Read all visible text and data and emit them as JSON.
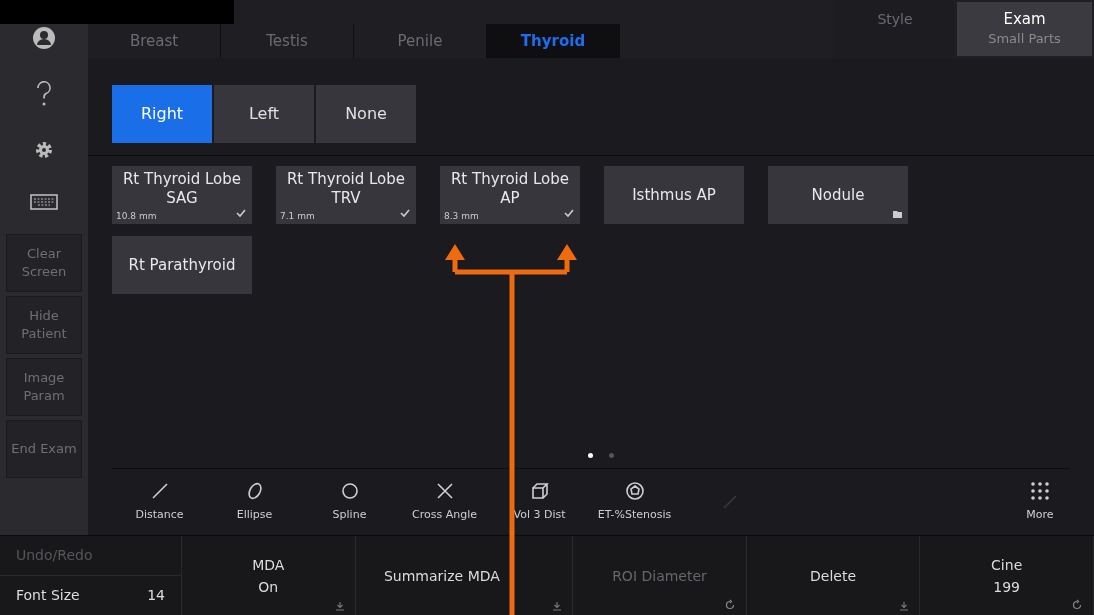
{
  "top_tabs": [
    {
      "label": "Breast",
      "selected": false
    },
    {
      "label": "Testis",
      "selected": false
    },
    {
      "label": "Penile",
      "selected": false
    },
    {
      "label": "Thyroid",
      "selected": true
    }
  ],
  "style_button": {
    "label": "Style",
    "disabled": true
  },
  "exam_button": {
    "label": "Exam",
    "value": "Small Parts"
  },
  "sidebar_buttons": [
    "Clear Screen",
    "Hide Patient",
    "Image Param",
    "End Exam"
  ],
  "sides": [
    {
      "label": "Right",
      "selected": true
    },
    {
      "label": "Left",
      "selected": false
    },
    {
      "label": "None",
      "selected": false
    }
  ],
  "measurements": [
    {
      "label": "Rt  Thyroid Lobe SAG",
      "value": "10.8 mm",
      "kind": "done"
    },
    {
      "label": "Rt  Thyroid Lobe TRV",
      "value": "7.1 mm",
      "kind": "done"
    },
    {
      "label": "Rt  Thyroid Lobe AP",
      "value": "8.3 mm",
      "kind": "done"
    },
    {
      "label": "Isthmus AP",
      "kind": "plain"
    },
    {
      "label": "Nodule",
      "kind": "folder"
    },
    {
      "label": "Rt  Parathyroid",
      "kind": "plain"
    }
  ],
  "pages": [
    {
      "selected": true
    },
    {
      "selected": false
    }
  ],
  "tools": [
    {
      "label": "Distance",
      "kind": "line",
      "disabled": false
    },
    {
      "label": "Ellipse",
      "kind": "ellipse",
      "disabled": false
    },
    {
      "label": "Spline",
      "kind": "spline",
      "disabled": false
    },
    {
      "label": "Cross Angle",
      "kind": "cross",
      "disabled": false
    },
    {
      "label": "Vol 3 Dist",
      "kind": "cube",
      "disabled": false
    },
    {
      "label": "ET-%Stenosis",
      "kind": "stenosis",
      "disabled": false
    },
    {
      "kind": "slash",
      "disabled": true
    }
  ],
  "more_button": {
    "label": "More"
  },
  "bottom": {
    "undo": "Undo/Redo",
    "font_size_label": "Font Size",
    "font_size": "14",
    "cells": [
      {
        "label": "MDA",
        "value": "On",
        "kind": "download",
        "disabled": false
      },
      {
        "label": "Summarize MDA",
        "kind": "download",
        "disabled": false
      },
      {
        "label": "ROI Diameter",
        "kind": "rotate",
        "disabled": true
      },
      {
        "label": "Delete",
        "kind": "download",
        "disabled": false
      },
      {
        "label": "Cine",
        "value": "199",
        "kind": "rotate",
        "disabled": false
      }
    ]
  }
}
